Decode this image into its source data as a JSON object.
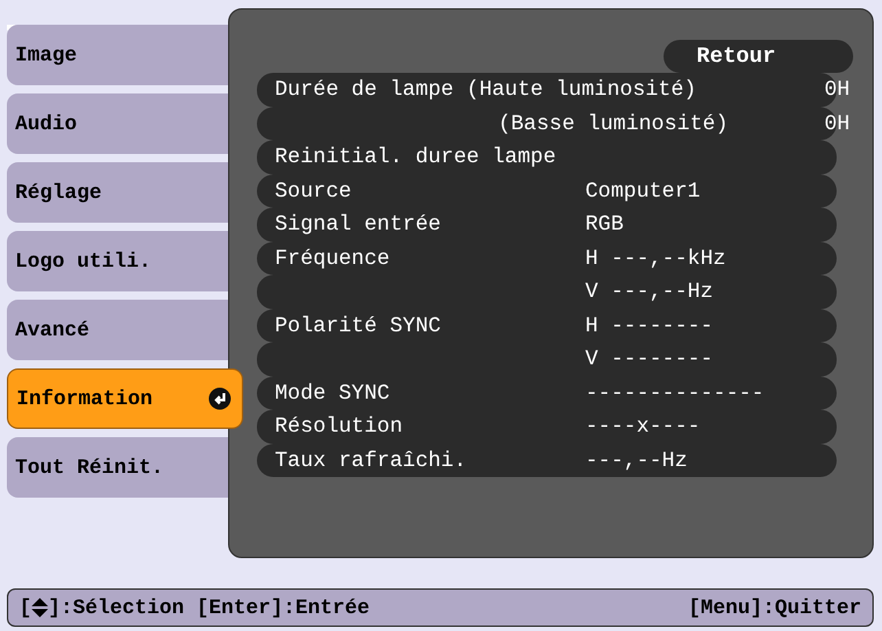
{
  "menu": [
    {
      "label": "Image",
      "selected": false
    },
    {
      "label": "Audio",
      "selected": false
    },
    {
      "label": "Réglage",
      "selected": false
    },
    {
      "label": "Logo utili.",
      "selected": false
    },
    {
      "label": "Avancé",
      "selected": false
    },
    {
      "label": "Information",
      "selected": true
    },
    {
      "label": "Tout Réinit.",
      "selected": false
    }
  ],
  "back_button": "Retour",
  "rows": [
    {
      "kind": "item",
      "label": "Durée de lampe (Haute luminosité)",
      "value": "0H"
    },
    {
      "kind": "sub",
      "label": "(Basse luminosité)",
      "value": "0H"
    },
    {
      "kind": "item",
      "label": "Reinitial. duree lampe"
    },
    {
      "kind": "item",
      "label": "Source",
      "value": "Computer1"
    },
    {
      "kind": "item",
      "label": "Signal entrée",
      "value": "RGB"
    },
    {
      "kind": "item",
      "label": "Fréquence",
      "value": "H ---,--kHz"
    },
    {
      "kind": "item",
      "value": "V ---,--Hz"
    },
    {
      "kind": "item",
      "label": "Polarité SYNC",
      "value": "H --------"
    },
    {
      "kind": "item",
      "value": "V --------"
    },
    {
      "kind": "item",
      "label": "Mode SYNC",
      "value": "--------------"
    },
    {
      "kind": "item",
      "label": "Résolution",
      "value": "----x----"
    },
    {
      "kind": "item",
      "label": "Taux rafraîchi.",
      "value": "---,--Hz"
    }
  ],
  "footer": {
    "open_bracket": "[",
    "select_hint": "]:Sélection [Enter]:Entrée",
    "quit_hint": "[Menu]:Quitter"
  }
}
